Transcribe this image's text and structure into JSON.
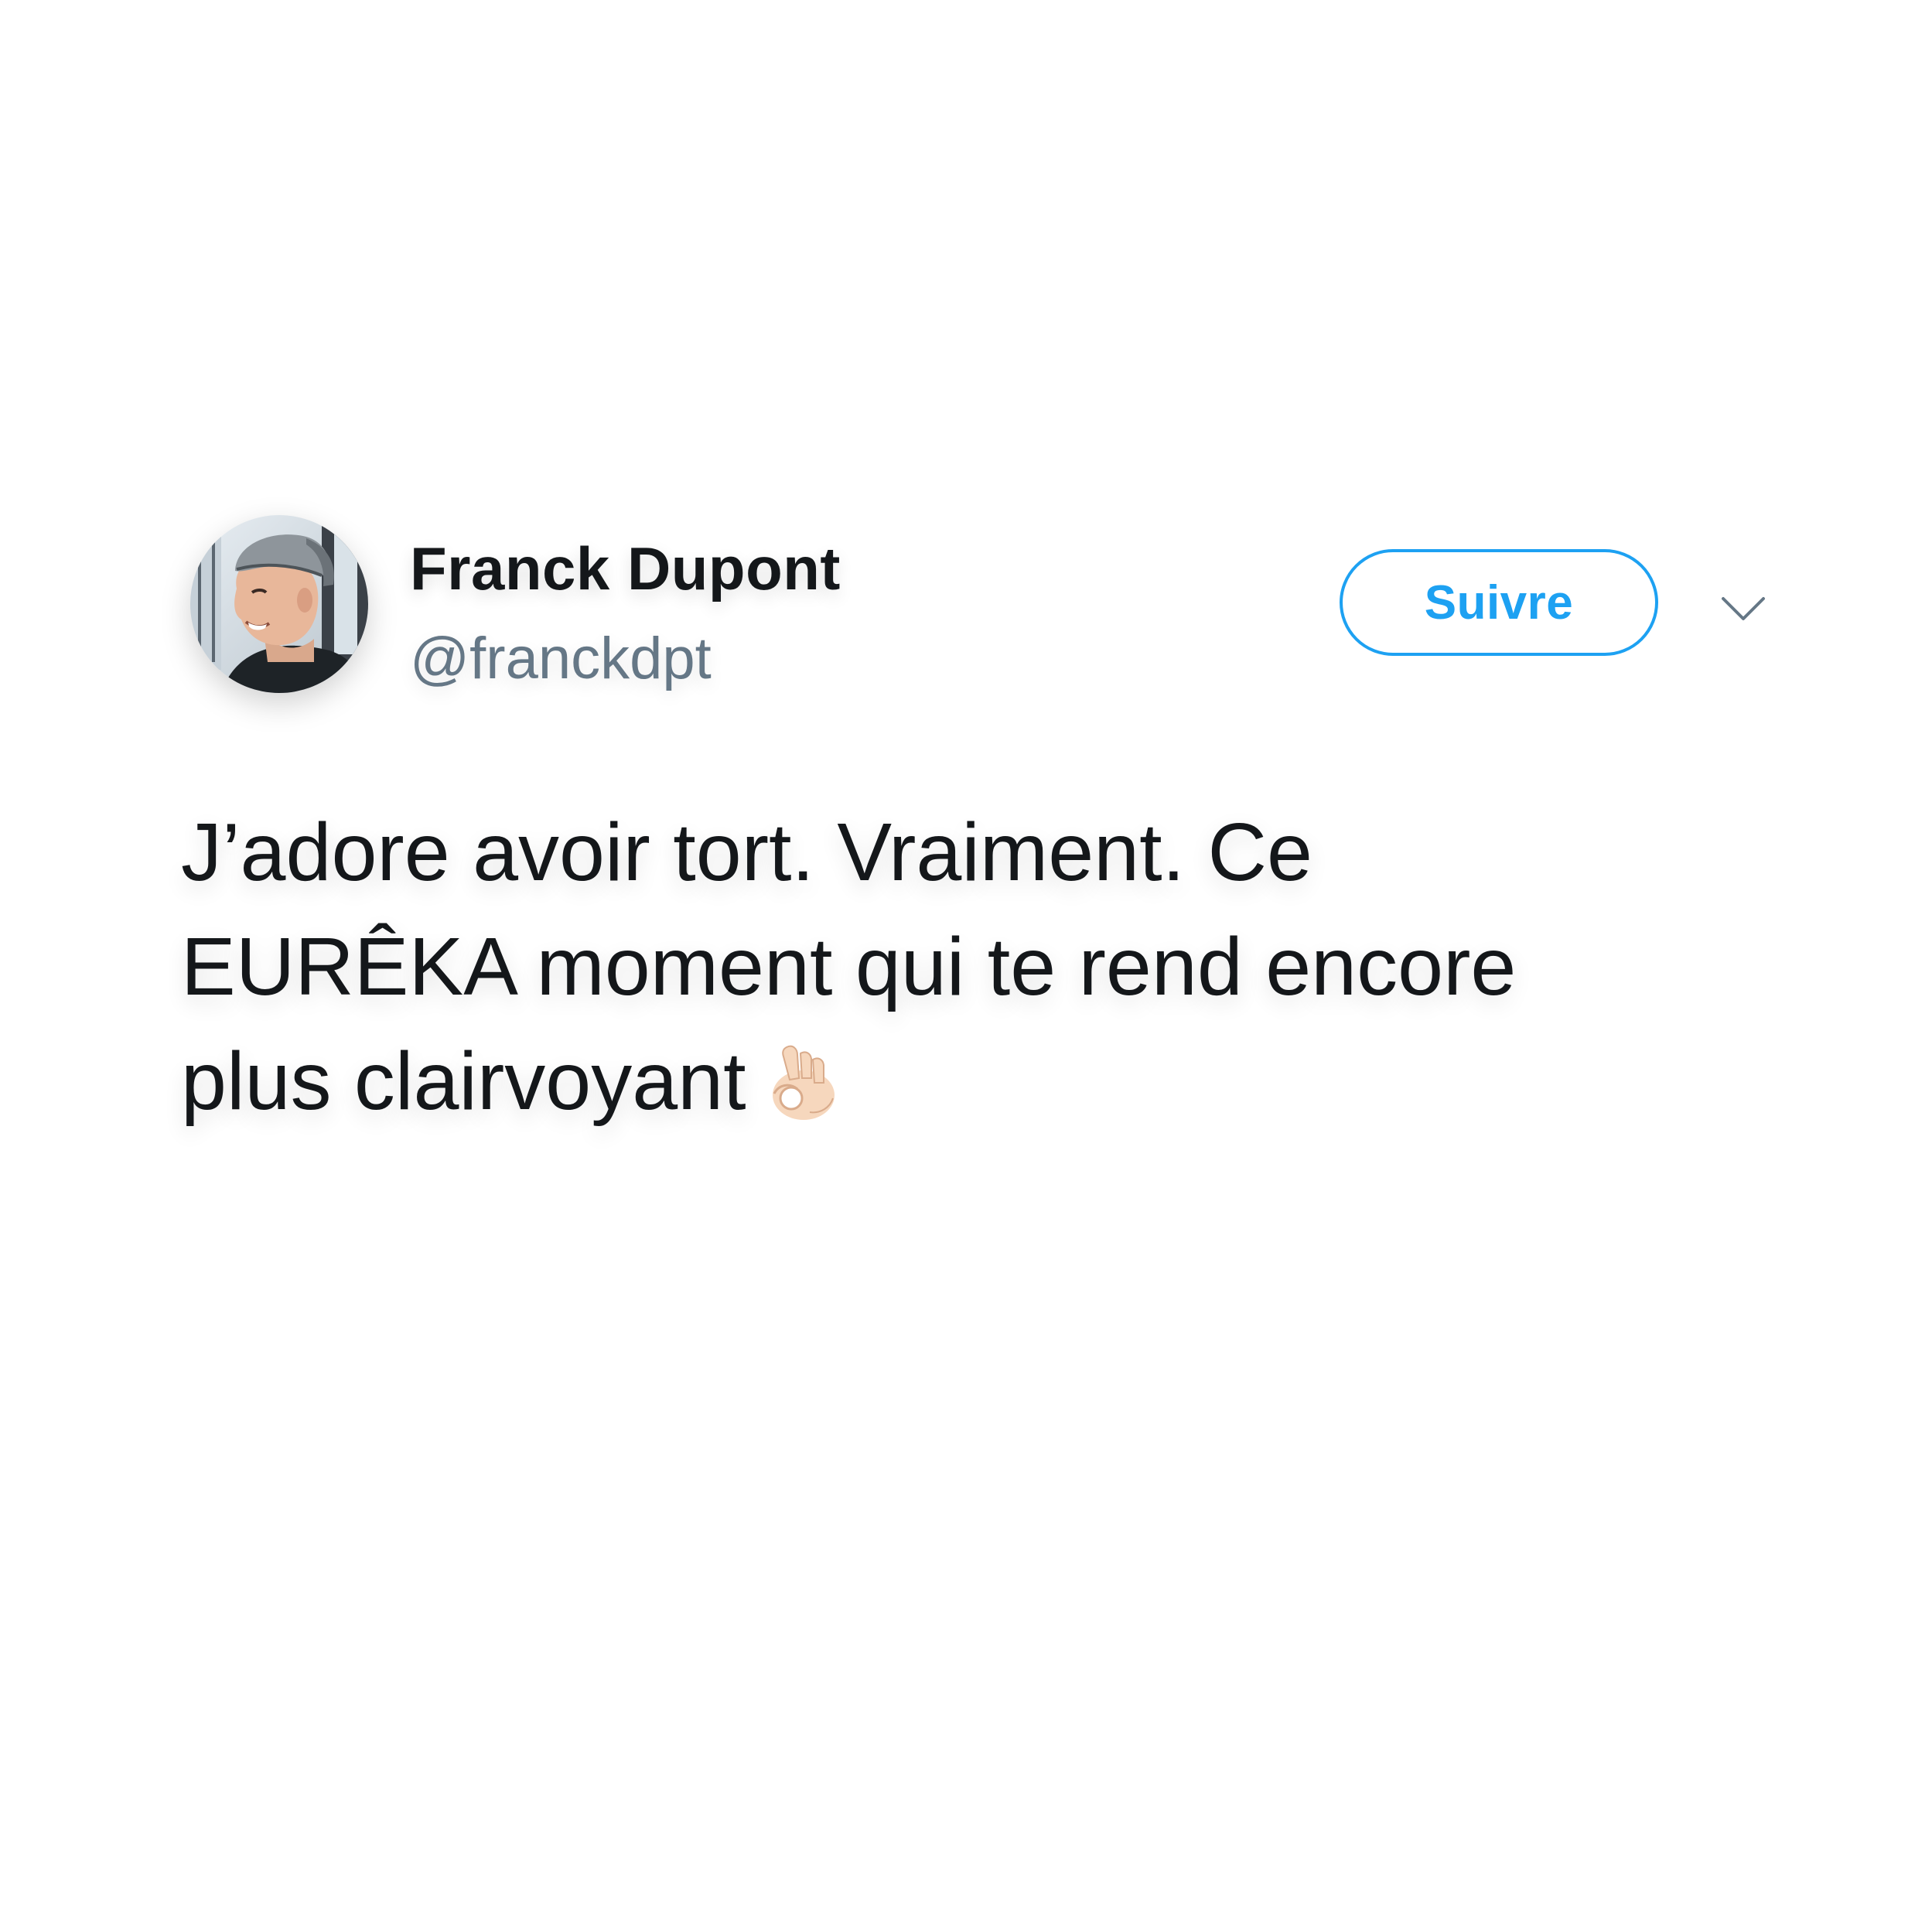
{
  "tweet": {
    "author": {
      "display_name": "Franck Dupont",
      "handle": "@franckdpt",
      "avatar": "avatar-photo"
    },
    "follow_button": {
      "label": "Suivre",
      "color": "#1da1f2"
    },
    "menu_icon": "chevron-down-icon",
    "text_lines": [
      "J’adore avoir tort. Vraiment. Ce",
      "EURÊKA moment qui te rend encore",
      "plus clairvoyant"
    ],
    "emoji": "ok-hand-emoji"
  },
  "colors": {
    "text": "#14171a",
    "handle": "#657786",
    "accent": "#1da1f2",
    "background": "#ffffff"
  }
}
